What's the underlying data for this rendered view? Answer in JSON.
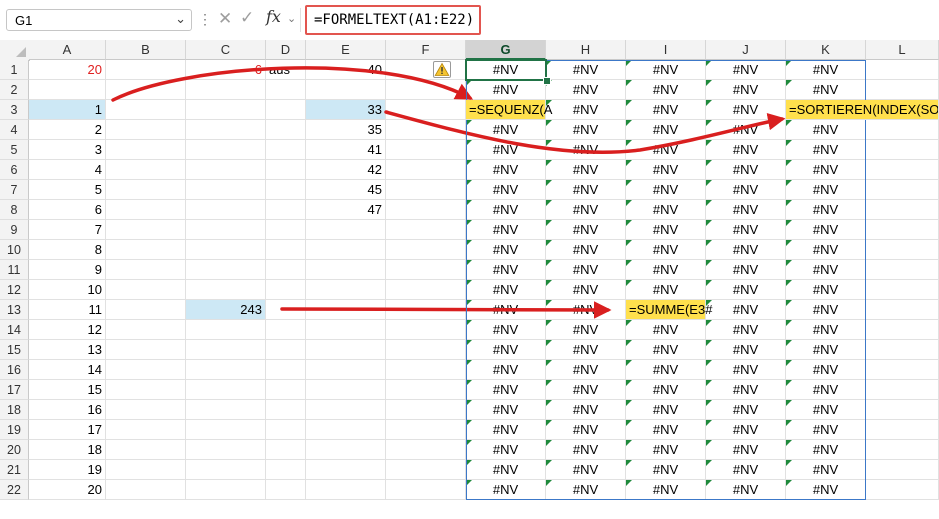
{
  "formula_bar": {
    "name_box": "G1",
    "formula": "=FORMELTEXT(A1:E22)"
  },
  "columns": [
    "A",
    "B",
    "C",
    "D",
    "E",
    "F",
    "G",
    "H",
    "I",
    "J",
    "K",
    "L"
  ],
  "selected_column": "G",
  "rows": [
    "1",
    "2",
    "3",
    "4",
    "5",
    "6",
    "7",
    "8",
    "9",
    "10",
    "11",
    "12",
    "13",
    "14",
    "15",
    "16",
    "17",
    "18",
    "19",
    "20",
    "21",
    "22"
  ],
  "cells": {
    "A1": "20",
    "C1": "6",
    "D1": "aus",
    "E1": "40",
    "A3": "1",
    "A4": "2",
    "A5": "3",
    "A6": "4",
    "A7": "5",
    "A8": "6",
    "A9": "7",
    "A10": "8",
    "A11": "9",
    "A12": "10",
    "A13": "11",
    "A14": "12",
    "A15": "13",
    "A16": "14",
    "A17": "15",
    "A18": "16",
    "A19": "17",
    "A20": "18",
    "A21": "19",
    "A22": "20",
    "E3": "33",
    "E4": "35",
    "E5": "41",
    "E6": "42",
    "E7": "45",
    "E8": "47",
    "C13": "243",
    "G3": "=SEQUENZ(A",
    "I13": "=SUMME(E3#",
    "K3": "=SORTIEREN(INDEX(SORT"
  },
  "spill_value": "#NV",
  "colors": {
    "red_text": "#e02020",
    "selection_fill": "#cde8f5",
    "formula_highlight": "#ffe04d",
    "arrow": "#d91f1f",
    "spill_border": "#3c78c8",
    "active_border": "#217346"
  },
  "icons": [
    "name-box-chevron-icon",
    "cancel-x-icon",
    "enter-check-icon",
    "fx-icon",
    "warning-icon",
    "error-indicator-icon"
  ]
}
